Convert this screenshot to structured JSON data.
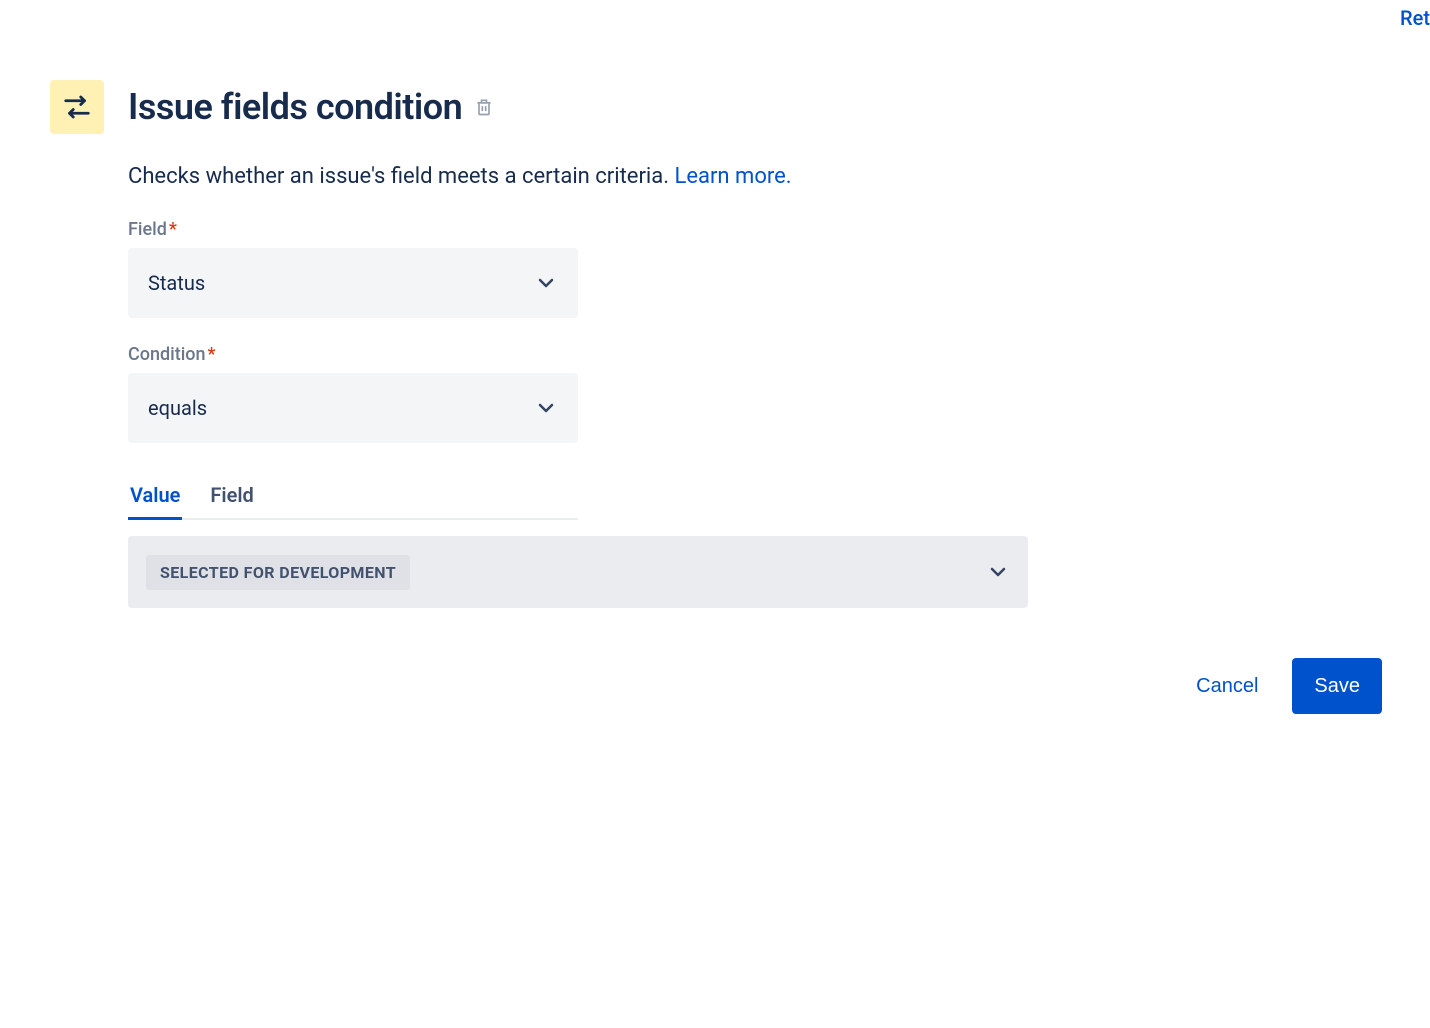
{
  "topLink": "Ret",
  "header": {
    "title": "Issue fields condition"
  },
  "description": {
    "text": "Checks whether an issue's field meets a certain criteria. ",
    "learnMore": "Learn more."
  },
  "fields": {
    "field": {
      "label": "Field",
      "value": "Status"
    },
    "condition": {
      "label": "Condition",
      "value": "equals"
    }
  },
  "tabs": {
    "value": "Value",
    "field": "Field"
  },
  "valueSelect": {
    "selected": "SELECTED FOR DEVELOPMENT"
  },
  "buttons": {
    "cancel": "Cancel",
    "save": "Save"
  }
}
